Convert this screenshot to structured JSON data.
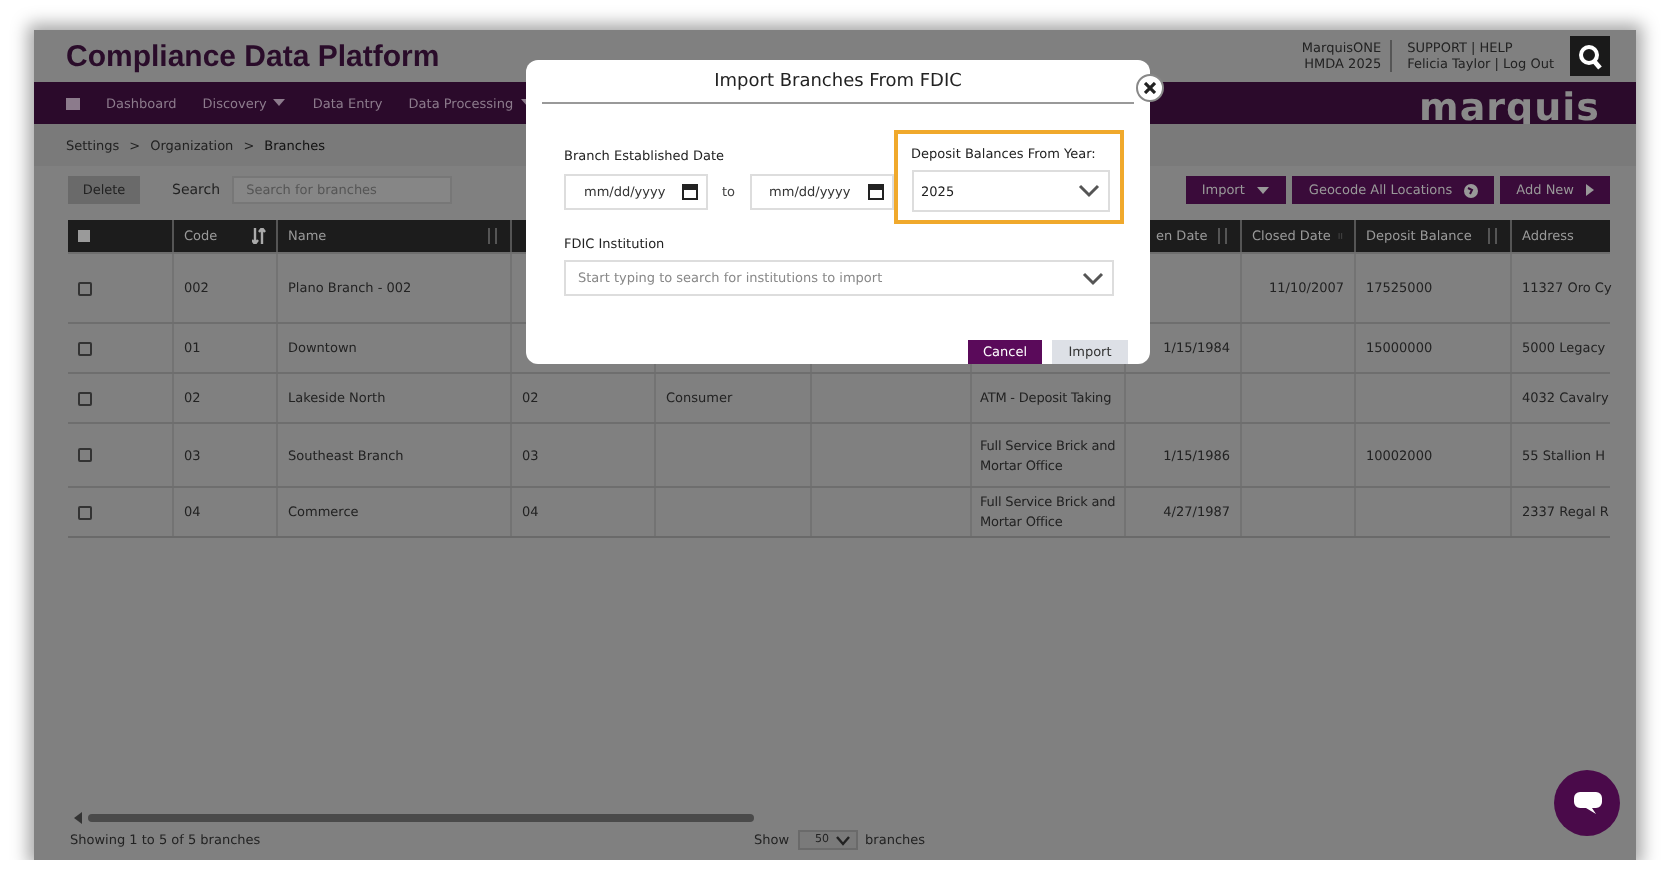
{
  "app": {
    "title": "Compliance Data Platform",
    "logo": "marquis"
  },
  "account": {
    "products": [
      "MarquisONE",
      "HMDA 2025"
    ],
    "links": [
      "SUPPORT | HELP",
      "Felicia Taylor | Log Out"
    ]
  },
  "nav": [
    {
      "label": "Dashboard",
      "dropdown": false
    },
    {
      "label": "Discovery",
      "dropdown": true
    },
    {
      "label": "Data Entry",
      "dropdown": false
    },
    {
      "label": "Data Processing",
      "dropdown": true
    }
  ],
  "breadcrumb": [
    {
      "kind": "link",
      "text": "Settings"
    },
    {
      "kind": "separator",
      "text": ">"
    },
    {
      "kind": "link",
      "text": "Organization"
    },
    {
      "kind": "separator",
      "text": ">"
    },
    {
      "kind": "current",
      "text": "Branches"
    }
  ],
  "toolbar": {
    "delete": "Delete",
    "search_label": "Search",
    "search_placeholder": "Search for branches",
    "actions": [
      {
        "label": "Import",
        "kind": "caret"
      },
      {
        "label": "Geocode All Locations",
        "kind": "globe"
      },
      {
        "label": "Add New",
        "kind": "arrow"
      }
    ]
  },
  "table": {
    "header": {
      "checked": false,
      "code": "Code",
      "name": "Name",
      "open_date": "en Date",
      "closed_date": "Closed Date",
      "deposit_balance": "Deposit Balance",
      "address": "Address"
    },
    "rows": [
      {
        "checked": false,
        "code": "002",
        "name": "Plano Branch - 002",
        "closed_date": "11/10/2007",
        "deposit_balance": "17525000",
        "address": "11327 Oro Cy"
      },
      {
        "checked": false,
        "code": "01",
        "name": "Downtown",
        "open_date": "1/15/1984",
        "deposit_balance": "15000000",
        "address": "5000 Legacy"
      },
      {
        "checked": false,
        "code": "02",
        "name": "Lakeside North",
        "column_4": "02",
        "column_5": "Consumer",
        "column_7": "ATM - Deposit Taking",
        "address": "4032 Cavalry"
      },
      {
        "checked": false,
        "code": "03",
        "name": "Southeast Branch",
        "column_4": "03",
        "column_7": "Full Service Brick and Mortar Office",
        "open_date": "1/15/1986",
        "deposit_balance": "10002000",
        "address": "55 Stallion H"
      },
      {
        "checked": false,
        "code": "04",
        "name": "Commerce",
        "column_4": "04",
        "column_7": "Full Service Brick and Mortar Office",
        "open_date": "4/27/1987",
        "address": "2337 Regal R"
      }
    ]
  },
  "footer": {
    "summary": "Showing 1 to 5 of 5 branches",
    "show_label": "Show",
    "page_size": "50",
    "unit_label": "branches"
  },
  "modal": {
    "title": "Import Branches From FDIC",
    "date_label": "Branch Established Date",
    "date_from_placeholder": "mm/dd/yyyy",
    "range_word": "to",
    "date_to_placeholder": "mm/dd/yyyy",
    "year_label": "Deposit Balances From Year:",
    "year_value": "2025",
    "year_highlighted": true,
    "institution_label": "FDIC Institution",
    "institution_placeholder": "Start typing to search for institutions to import",
    "buttons": [
      {
        "label": "Cancel",
        "kind": "primary"
      },
      {
        "label": "Import",
        "kind": "secondary"
      }
    ]
  }
}
